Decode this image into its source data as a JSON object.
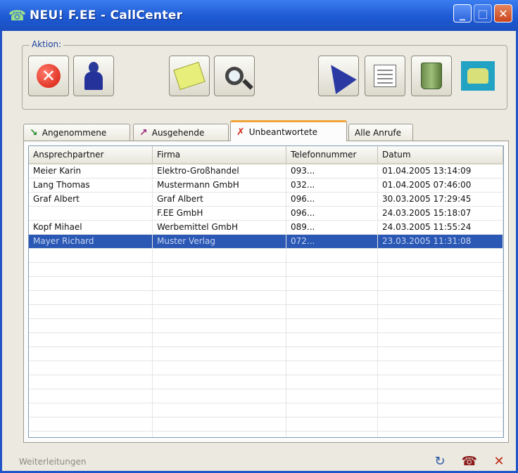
{
  "window": {
    "title": "NEU! F.EE - CallCenter"
  },
  "toolbar": {
    "group_label": "Aktion:",
    "buttons": [
      {
        "icon": "cancel-icon"
      },
      {
        "icon": "person-icon"
      },
      {
        "icon": "note-icon"
      },
      {
        "icon": "search-icon"
      },
      {
        "icon": "forward-arrow-icon"
      },
      {
        "icon": "edit-form-icon"
      },
      {
        "icon": "recycle-bin-icon"
      },
      {
        "icon": "telephone-icon"
      }
    ]
  },
  "tabs": [
    {
      "label": "Angenommene",
      "icon": "accepted-call-icon"
    },
    {
      "label": "Ausgehende",
      "icon": "outgoing-call-icon"
    },
    {
      "label": "Unbeantwortete",
      "icon": "missed-call-icon",
      "active": true
    },
    {
      "label": "Alle Anrufe",
      "icon": ""
    }
  ],
  "table": {
    "columns": [
      "Ansprechpartner",
      "Firma",
      "Telefonnummer",
      "Datum"
    ],
    "rows": [
      [
        "Meier Karin",
        "Elektro-Großhandel",
        "093...",
        "01.04.2005 13:14:09"
      ],
      [
        "Lang Thomas",
        "Mustermann GmbH",
        "032...",
        "01.04.2005 07:46:00"
      ],
      [
        "Graf Albert",
        "Graf Albert",
        "096...",
        "30.03.2005 17:29:45"
      ],
      [
        "",
        "F.EE GmbH",
        "096...",
        "24.03.2005 15:18:07"
      ],
      [
        "Kopf Mihael",
        "Werbemittel GmbH",
        "089...",
        "24.03.2005 11:55:24"
      ],
      [
        "Mayer Richard",
        "Muster Verlag",
        "072...",
        "23.03.2005 11:31:08"
      ]
    ],
    "selected_row": 5
  },
  "statusbar": {
    "text": "Weiterleitungen"
  },
  "colors": {
    "titlebar": "#1e5ad3",
    "selection": "#2a58b4",
    "active_tab_accent": "#f0a33a"
  }
}
